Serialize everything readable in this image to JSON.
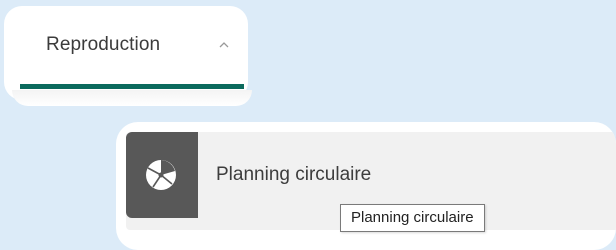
{
  "tab": {
    "label": "Reproduction",
    "expanded_icon": "chevron-up-icon",
    "accent_color": "#0b6a5d"
  },
  "item": {
    "label": "Planning circulaire",
    "icon": "pie-chart-icon",
    "icon_bg": "#585858"
  },
  "tooltip": {
    "text": "Planning circulaire"
  }
}
